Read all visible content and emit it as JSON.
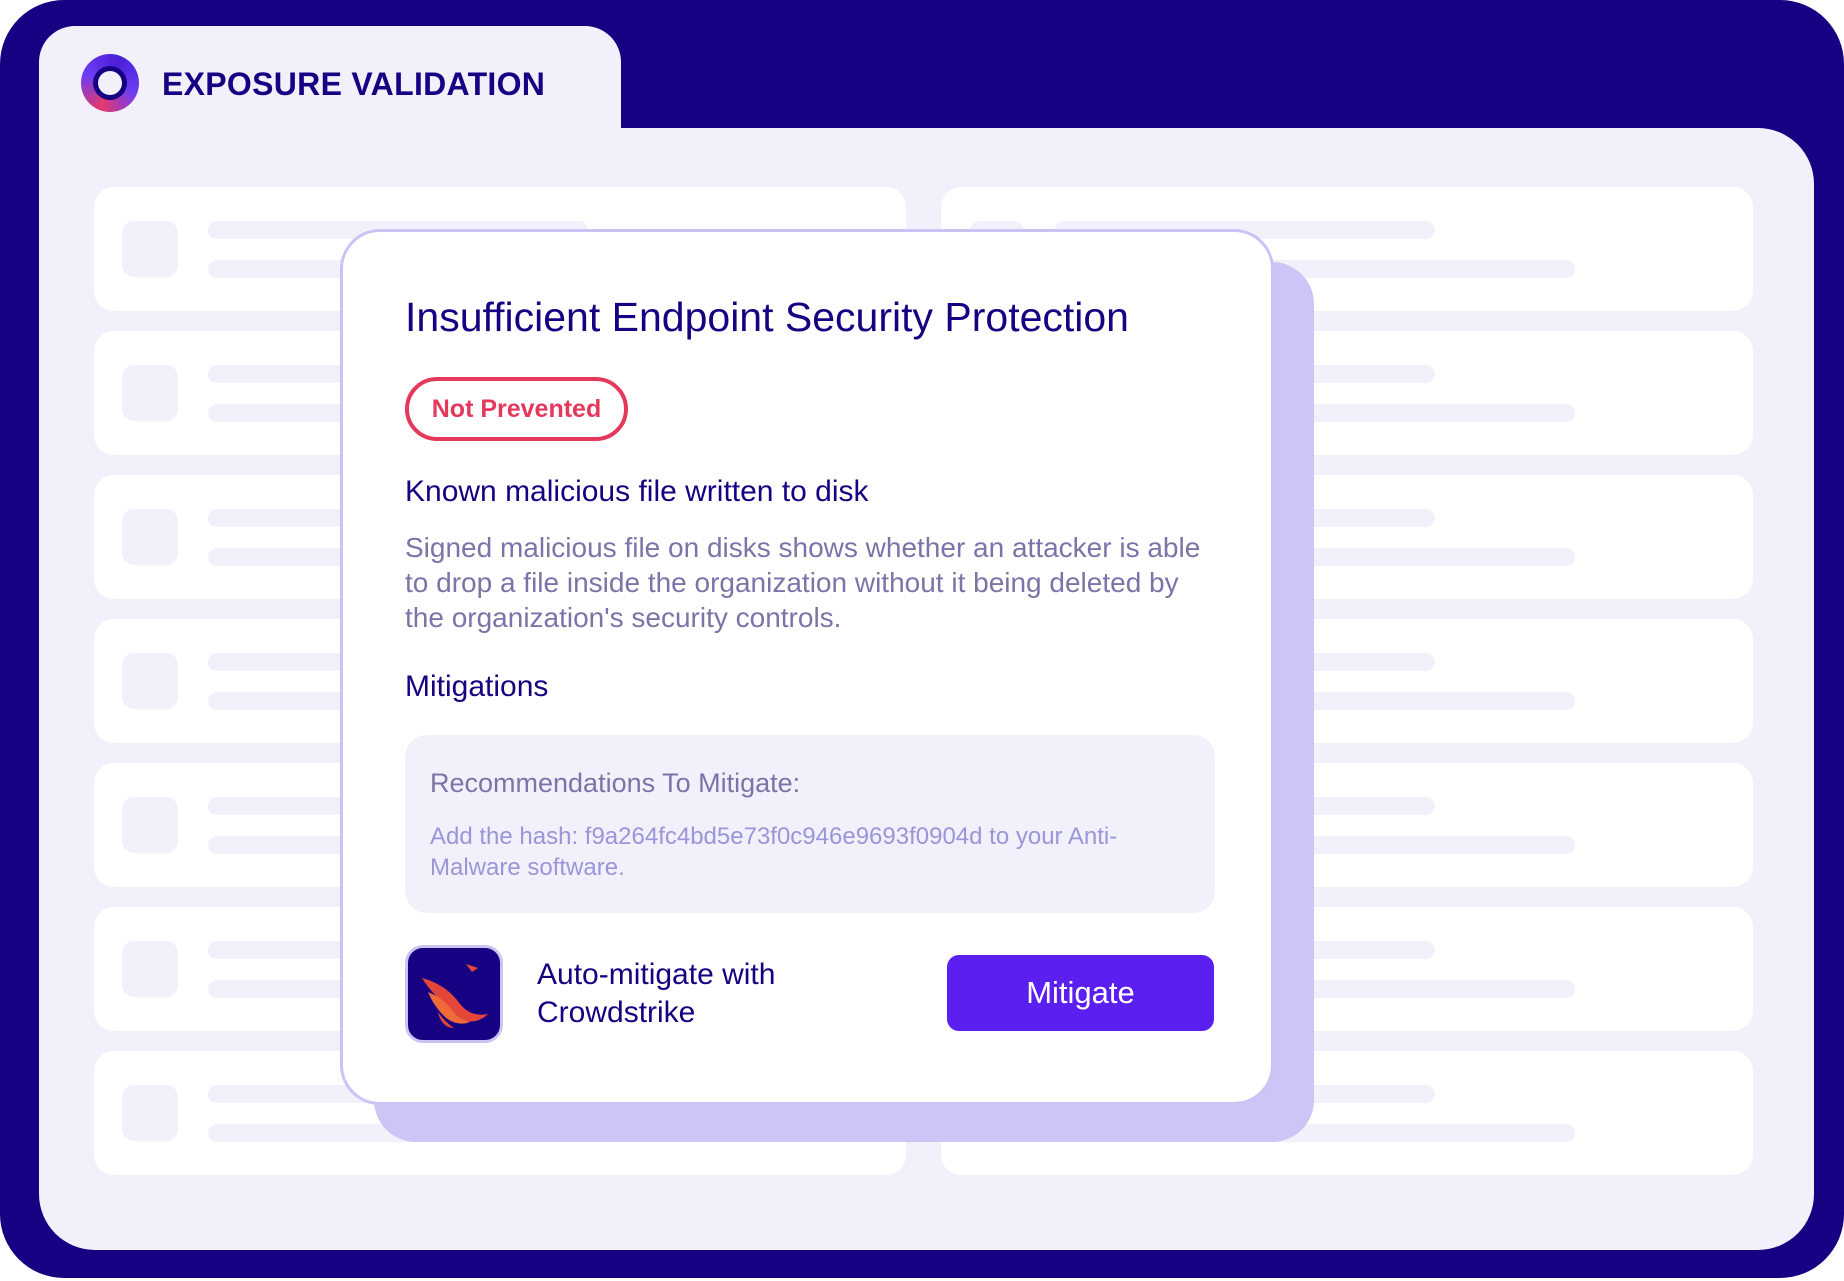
{
  "app": {
    "title": "EXPOSURE VALIDATION",
    "logo_icon": "ring-logo-icon"
  },
  "finding": {
    "title": "Insufficient Endpoint Security Protection",
    "status_badge": "Not Prevented",
    "subtitle": "Known malicious file written to disk",
    "description": "Signed malicious file on disks shows whether an attacker is able to drop a file inside the organization without it being deleted by the organization's security controls.",
    "mitigations_heading": "Mitigations",
    "recommendation_heading": "Recommendations To Mitigate:",
    "recommendation_text": "Add the hash: f9a264fc4bd5e73f0c946e9693f0904d to your Anti-Malware software.",
    "auto_mitigate_label": "Auto-mitigate with Crowdstrike",
    "integration_icon": "crowdstrike-falcon-icon",
    "mitigate_button": "Mitigate"
  },
  "colors": {
    "frame": "#170182",
    "panel": "#f1f0fb",
    "accent_button": "#5b1ff0",
    "status_red": "#e5395b",
    "modal_shadow": "#cbc6f6"
  }
}
